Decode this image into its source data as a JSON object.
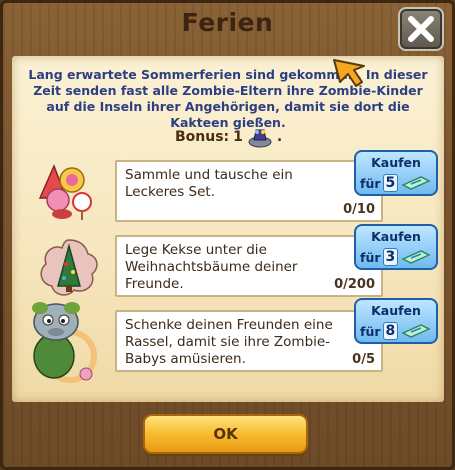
{
  "dialog": {
    "title": "Ferien",
    "description": "Lang erwartete Sommerferien sind gekommen. In dieser Zeit senden fast alle Zombie-Eltern ihre Zombie-Kinder auf die Inseln ihrer Angehörigen, damit sie dort die Kakteen gießen.",
    "bonus_label": "Bonus:",
    "bonus_value": "1",
    "bonus_suffix": ".",
    "ok_label": "OK"
  },
  "tasks": [
    {
      "text": "Sammle und tausche ein Leckeres Set.",
      "progress": "0/10",
      "buy_label": "Kaufen",
      "buy_for": "für",
      "buy_cost": "5",
      "image_icon": "candy-set-icon"
    },
    {
      "text": "Lege Kekse unter die Weihnachtsbäume deiner Freunde.",
      "progress": "0/200",
      "buy_label": "Kaufen",
      "buy_for": "für",
      "buy_cost": "3",
      "image_icon": "christmas-cookie-icon"
    },
    {
      "text": "Schenke deinen Freunden eine Rassel, damit sie ihre Zombie-Babys amüsieren.",
      "progress": "0/5",
      "buy_label": "Kaufen",
      "buy_for": "für",
      "buy_cost": "8",
      "image_icon": "zombie-baby-rattle-icon"
    }
  ],
  "colors": {
    "description_text": "#2c3f82",
    "buy_button": "#6fbaf0",
    "ok_button": "#f6b82c",
    "parchment": "#f6e6bd"
  }
}
